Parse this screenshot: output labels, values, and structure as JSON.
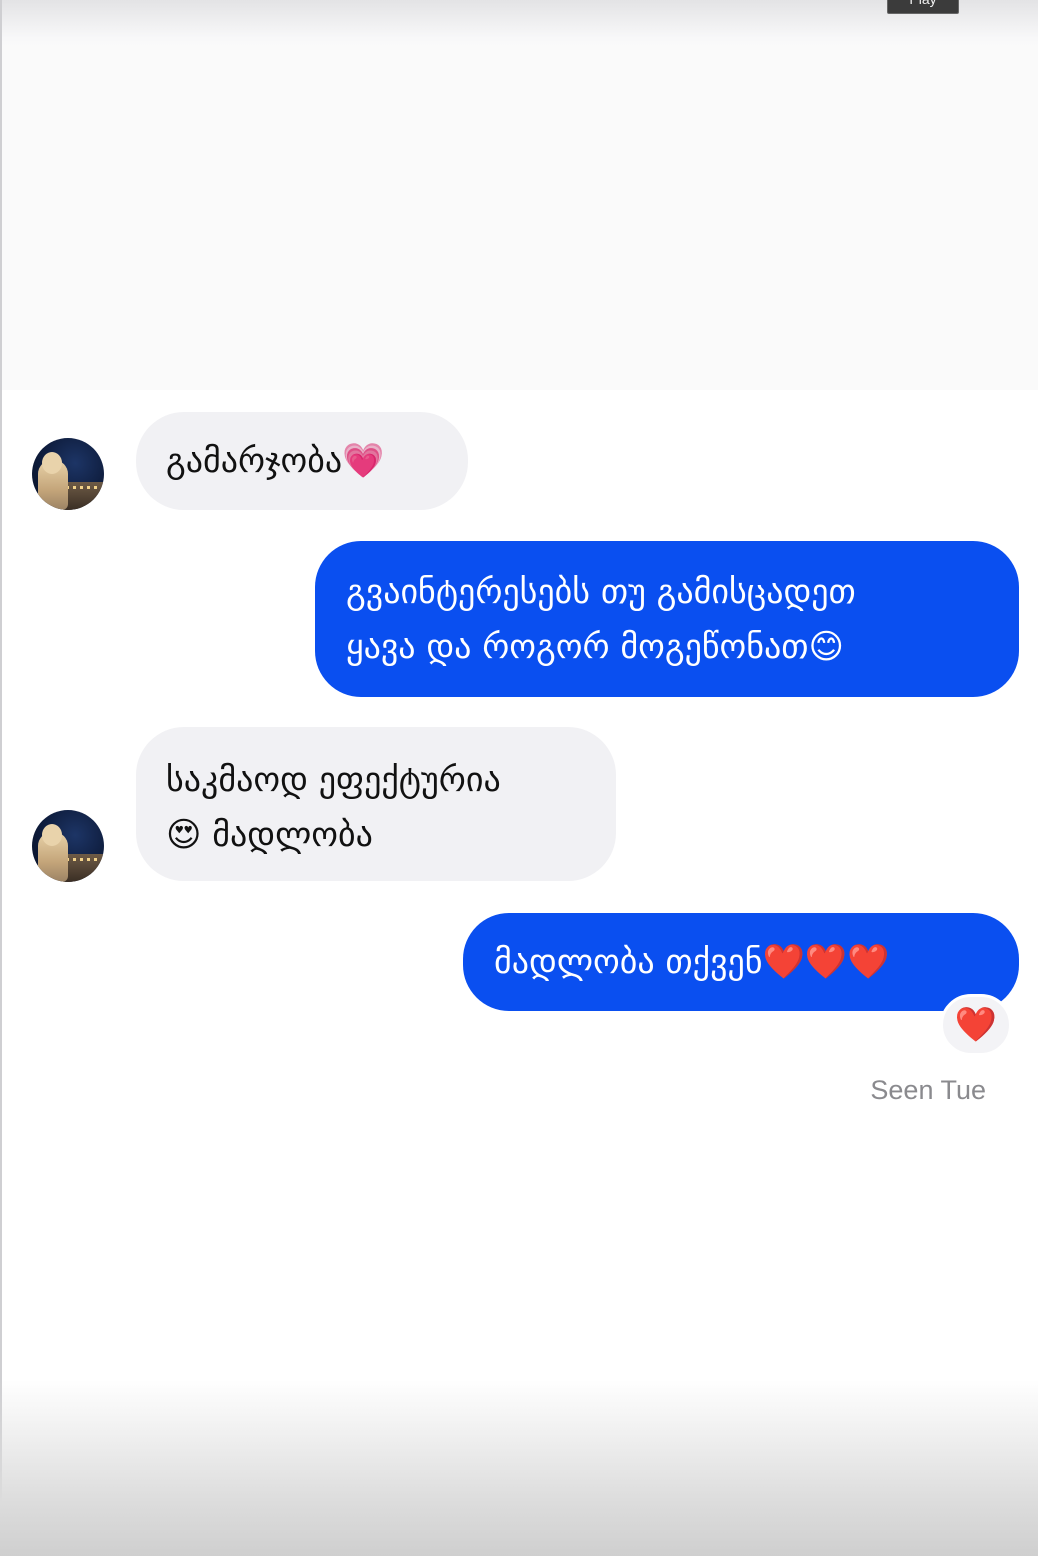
{
  "overlay": {
    "play_label": "Play"
  },
  "conversation": {
    "messages": [
      {
        "direction": "incoming",
        "text": "გამარჯობა💗"
      },
      {
        "direction": "outgoing",
        "text": "გვაინტერესებს თუ გამისცადეთ\nყავა და როგორ მოგეწონათ😊"
      },
      {
        "direction": "incoming",
        "text": "საკმაოდ ეფექტურია\n😍 მადლობა"
      },
      {
        "direction": "outgoing",
        "text": "მადლობა თქვენ❤️❤️❤️"
      }
    ],
    "reaction": "❤️",
    "status": "Seen Tue"
  },
  "colors": {
    "outgoing_bubble": "#0a4ff0",
    "incoming_bubble": "#f1f1f4",
    "status_text": "#8a8a8e"
  },
  "icons": {
    "avatar": "contact-avatar",
    "reaction": "heart-reaction-icon"
  }
}
